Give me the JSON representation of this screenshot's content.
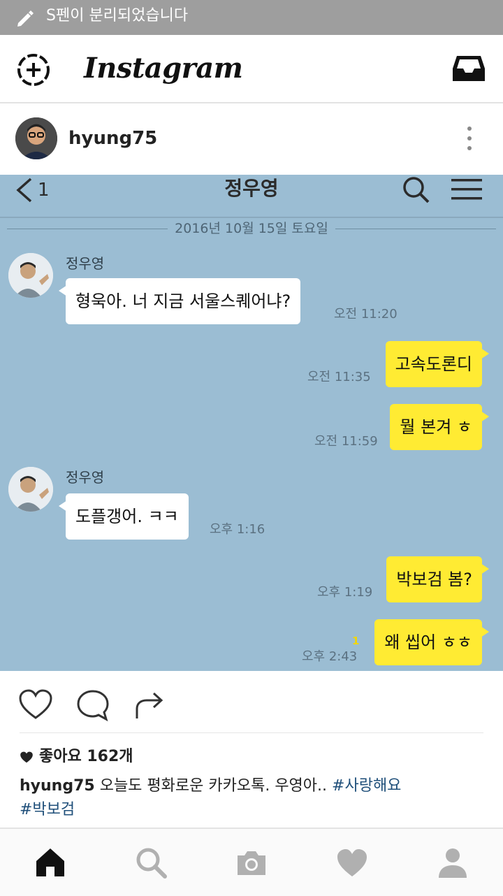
{
  "status_bar": {
    "notification": "S펜이 분리되었습니다"
  },
  "app": {
    "title": "Instagram"
  },
  "post": {
    "username": "hyung75",
    "likes_text": "좋아요 162개",
    "caption": {
      "username": "hyung75",
      "text": "오늘도 평화로운 카카오톡. 우영아..",
      "tags": [
        "#사랑해요",
        "#박보검"
      ]
    }
  },
  "chat": {
    "back_count": "1",
    "room_title": "정우영",
    "date_separator": "2016년 10월 15일 토요일",
    "messages": [
      {
        "sender": "정우영",
        "text": "형욱아. 너 지금 서울스퀘어냐?",
        "time": "오전 11:20"
      },
      {
        "sender": "me",
        "text": "고속도론디",
        "time": "오전 11:35"
      },
      {
        "sender": "me",
        "text": "뭘 본겨 ㅎ",
        "time": "오전 11:59"
      },
      {
        "sender": "정우영",
        "text": "도플갱어. ㅋㅋ",
        "time": "오후 1:16"
      },
      {
        "sender": "me",
        "text": "박보검 봄?",
        "time": "오후 1:19"
      },
      {
        "sender": "me",
        "text": "왜 씹어 ㅎㅎ",
        "time": "오후 2:43",
        "unread": "1"
      }
    ]
  },
  "colors": {
    "chat_background": "#9bbdd3",
    "my_bubble": "#ffeb33",
    "friend_bubble": "#ffffff",
    "hashtag": "#1f4f7a"
  },
  "icons": {
    "status": "pen-icon",
    "header_left": "new-story-icon",
    "header_right": "inbox-icon",
    "actions": [
      "heart-outline-icon",
      "comment-icon",
      "share-icon"
    ],
    "nav": [
      "home-icon",
      "search-icon",
      "camera-icon",
      "heart-icon",
      "profile-icon"
    ]
  }
}
